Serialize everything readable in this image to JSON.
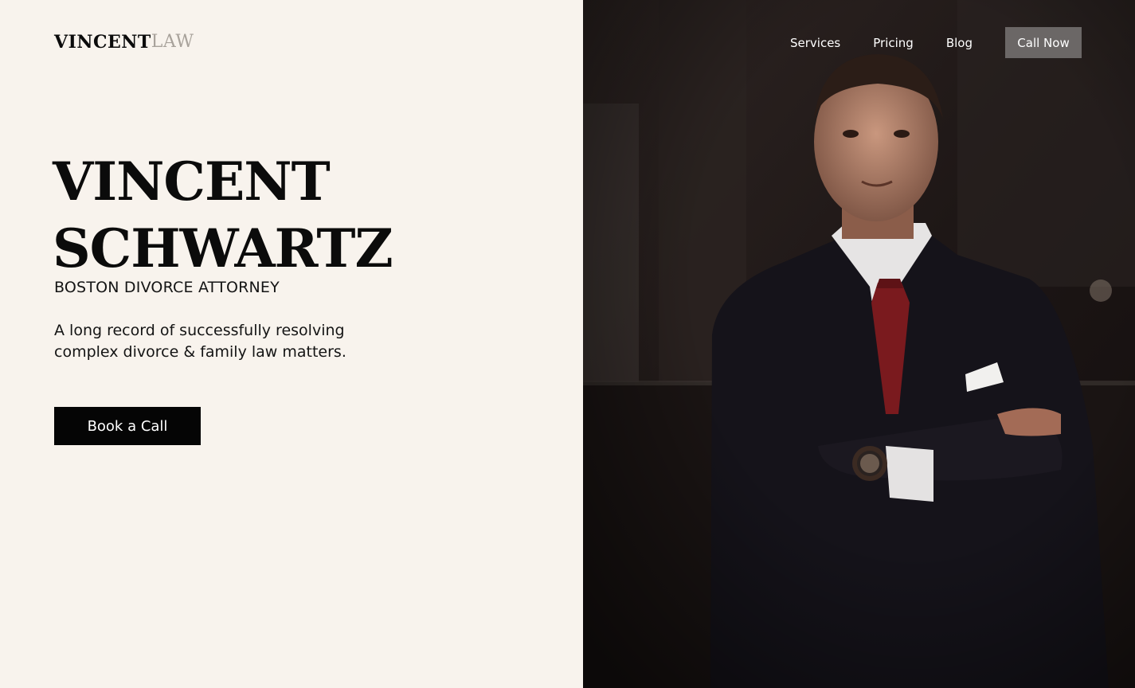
{
  "brand": {
    "logo_part1": "VINCENT",
    "logo_part2": "LAW"
  },
  "hero": {
    "title_line1": "VINCENT",
    "title_line2": "SCHWARTZ",
    "subtitle": "BOSTON DIVORCE ATTORNEY",
    "description": "A long record of successfully resolving complex divorce & family law matters.",
    "cta_label": "Book a Call"
  },
  "nav": {
    "items": [
      {
        "label": "Services"
      },
      {
        "label": "Pricing"
      },
      {
        "label": "Blog"
      }
    ],
    "call_label": "Call Now"
  },
  "colors": {
    "background": "#f8f3ed",
    "text": "#0b0b0b",
    "logo_muted": "#a8a29b",
    "cta_bg": "#050505",
    "call_btn_bg": "#6b6766",
    "photo_bg": "#1c1514",
    "tie": "#7a1a1e"
  }
}
